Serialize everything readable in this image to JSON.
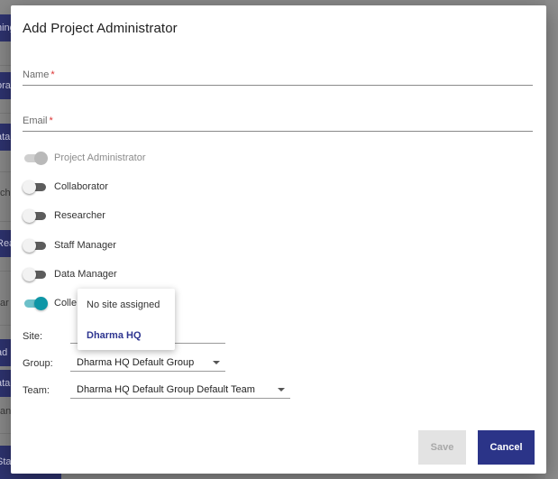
{
  "background": {
    "chips": [
      "hing",
      "ora",
      "ata",
      "Rea",
      "ad",
      "ata",
      "Staff"
    ],
    "texts": [
      "ch",
      "ar",
      "an"
    ]
  },
  "modal": {
    "title": "Add Project Administrator",
    "name_field": {
      "label": "Name",
      "required_mark": "*",
      "value": ""
    },
    "email_field": {
      "label": "Email",
      "required_mark": "*",
      "value": ""
    },
    "roles": [
      {
        "label": "Project Administrator",
        "enabled": true,
        "disabled": true
      },
      {
        "label": "Collaborator",
        "enabled": false,
        "disabled": false
      },
      {
        "label": "Researcher",
        "enabled": false,
        "disabled": false
      },
      {
        "label": "Staff Manager",
        "enabled": false,
        "disabled": false
      },
      {
        "label": "Data Manager",
        "enabled": false,
        "disabled": false
      },
      {
        "label": "Colle",
        "enabled": true,
        "disabled": false
      }
    ],
    "site": {
      "label": "Site:",
      "value": ""
    },
    "group": {
      "label": "Group:",
      "value": "Dharma HQ Default Group"
    },
    "team": {
      "label": "Team:",
      "value": "Dharma HQ Default Group Default Team"
    },
    "site_dropdown": {
      "options": [
        {
          "label": "No site assigned",
          "selected": false
        },
        {
          "label": "Dharma HQ",
          "selected": true
        }
      ]
    },
    "buttons": {
      "save": "Save",
      "cancel": "Cancel"
    }
  },
  "colors": {
    "accent": "#0e96a6",
    "primary_button": "#2b3488",
    "selected_option": "#2e3590",
    "required": "#dd3333"
  }
}
